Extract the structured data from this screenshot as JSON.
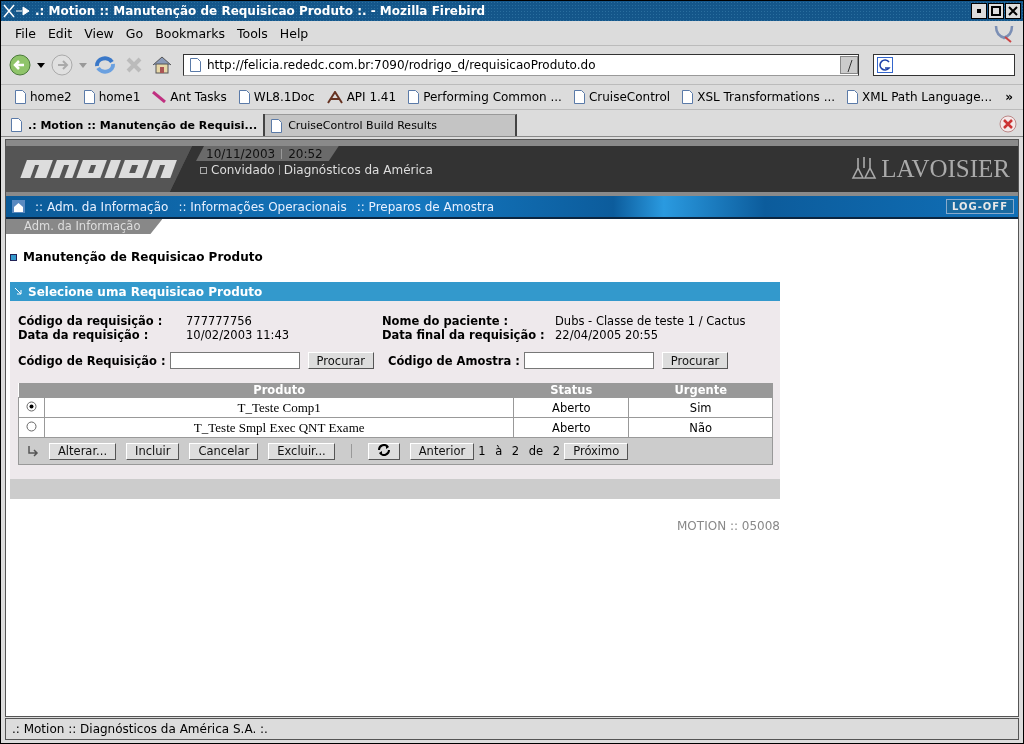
{
  "window": {
    "title": ".: Motion :: Manutenção de Requisicao Produto :. - Mozilla Firebird"
  },
  "menu": [
    "File",
    "Edit",
    "View",
    "Go",
    "Bookmarks",
    "Tools",
    "Help"
  ],
  "address": {
    "value": "http://felicia.rededc.com.br:7090/rodrigo_d/requisicaoProduto.do"
  },
  "bookmarks": [
    {
      "label": "home2",
      "kind": "page"
    },
    {
      "label": "home1",
      "kind": "page"
    },
    {
      "label": "Ant Tasks",
      "kind": "ant"
    },
    {
      "label": "WL8.1Doc",
      "kind": "page"
    },
    {
      "label": "API 1.41",
      "kind": "api"
    },
    {
      "label": "Performing Common ...",
      "kind": "page"
    },
    {
      "label": "CruiseControl",
      "kind": "page"
    },
    {
      "label": "XSL Transformations ...",
      "kind": "page"
    },
    {
      "label": "XML Path Language...",
      "kind": "page"
    }
  ],
  "bookmarks_more": "»",
  "tabs": [
    {
      "label": ".: Motion :: Manutenção de Requisi...",
      "selected": true
    },
    {
      "label": "CruiseControl Build Results",
      "selected": false
    }
  ],
  "header": {
    "date": "10/11/2003",
    "time": "20:52",
    "user": "Convidado",
    "company": "Diagnósticos da América",
    "brand": "LAVOISIER"
  },
  "nav": {
    "items": [
      ":: Adm. da Informação",
      ":: Informações Operacionais",
      ":: Preparos de Amostra"
    ],
    "logoff": "LOG-OFF"
  },
  "breadcrumb": "Adm. da Informação",
  "page_title": "Manutenção de Requisicao Produto",
  "panel": {
    "title": "Selecione uma Requisicao Produto",
    "fields": [
      {
        "label": "Código da requisição :",
        "value": "777777756"
      },
      {
        "label": "Nome do paciente :",
        "value": "Dubs - Classe de teste 1 / Cactus"
      },
      {
        "label": "Data da requisição :",
        "value": "10/02/2003 11:43"
      },
      {
        "label": "Data final da requisição :",
        "value": "22/04/2005 20:55"
      }
    ],
    "searches": [
      {
        "label": "Código de Requisição :",
        "button": "Procurar"
      },
      {
        "label": "Código de Amostra :",
        "button": "Procurar"
      }
    ],
    "table": {
      "columns": [
        "Produto",
        "Status",
        "Urgente"
      ],
      "rows": [
        {
          "selected": true,
          "cells": [
            "T_Teste Comp1",
            "Aberto",
            "Sim"
          ]
        },
        {
          "selected": false,
          "cells": [
            "T_Teste Smpl Exec QNT Exame",
            "Aberto",
            "Não"
          ]
        }
      ]
    },
    "actions": [
      "Alterar...",
      "Incluir",
      "Cancelar",
      "Excluir..."
    ],
    "pager": {
      "previous": "Anterior",
      "position": "1 à 2 de 2",
      "next": "Próximo"
    }
  },
  "footer_code": "MOTION :: 05008",
  "status_bar": ".: Motion :: Diagnósticos da América S.A. :."
}
